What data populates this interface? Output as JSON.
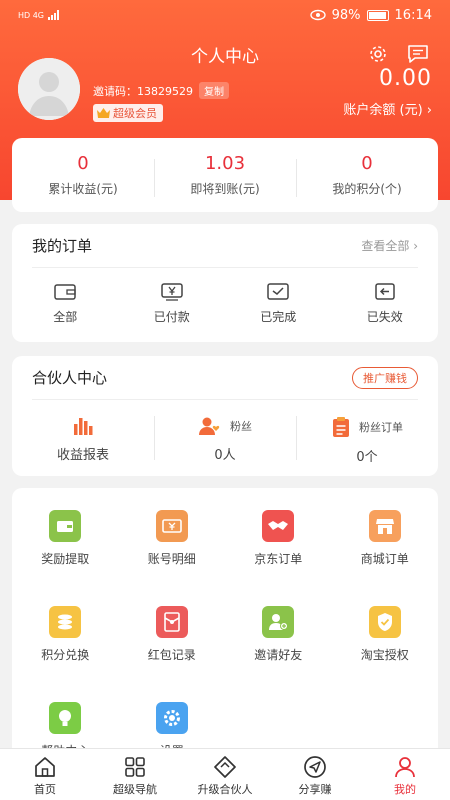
{
  "status_bar": {
    "left": "HD 4G",
    "battery": "98%",
    "time": "16:14"
  },
  "header": {
    "title": "个人中心"
  },
  "profile": {
    "invite_label": "邀请码：",
    "invite_code": "13829529",
    "copy_label": "复制",
    "vip_label": "超级会员",
    "balance_value": "0.00",
    "balance_label": "账户余额 (元) ›"
  },
  "stats": [
    {
      "value": "0",
      "label": "累计收益(元)"
    },
    {
      "value": "1.03",
      "label": "即将到账(元)"
    },
    {
      "value": "0",
      "label": "我的积分(个)"
    }
  ],
  "orders": {
    "title": "我的订单",
    "view_all": "查看全部 ›",
    "items": [
      {
        "label": "全部",
        "icon": "wallet-icon"
      },
      {
        "label": "已付款",
        "icon": "yen-icon"
      },
      {
        "label": "已完成",
        "icon": "check-icon"
      },
      {
        "label": "已失效",
        "icon": "return-icon"
      }
    ]
  },
  "partner": {
    "title": "合伙人中心",
    "promo": "推广赚钱",
    "report_label": "收益报表",
    "fans_label": "粉丝",
    "fans_value": "0人",
    "fan_orders_label": "粉丝订单",
    "fan_orders_value": "0个"
  },
  "tools": [
    {
      "label": "奖励提取",
      "icon": "wallet-icon",
      "color": "#8bc34a"
    },
    {
      "label": "账号明细",
      "icon": "card-icon",
      "color": "#f29a52"
    },
    {
      "label": "京东订单",
      "icon": "handshake-icon",
      "color": "#ef5350"
    },
    {
      "label": "商城订单",
      "icon": "store-icon",
      "color": "#f7a05d"
    },
    {
      "label": "积分兑换",
      "icon": "coins-icon",
      "color": "#f6c343"
    },
    {
      "label": "红包记录",
      "icon": "red-envelope-icon",
      "color": "#ec5b5b"
    },
    {
      "label": "邀请好友",
      "icon": "add-user-icon",
      "color": "#8bc34a"
    },
    {
      "label": "淘宝授权",
      "icon": "shield-icon",
      "color": "#f6c343"
    },
    {
      "label": "帮助中心",
      "icon": "bulb-icon",
      "color": "#7ccc45"
    },
    {
      "label": "设置",
      "icon": "gear-icon",
      "color": "#4aa3f0"
    }
  ],
  "tabbar": [
    {
      "label": "首页",
      "icon": "home-icon"
    },
    {
      "label": "超级导航",
      "icon": "grid-icon"
    },
    {
      "label": "升级合伙人",
      "icon": "diamond-icon"
    },
    {
      "label": "分享赚",
      "icon": "send-icon"
    },
    {
      "label": "我的",
      "icon": "person-icon"
    }
  ],
  "colors": {
    "accent": "#f7462f",
    "value_red": "#e8303a"
  }
}
